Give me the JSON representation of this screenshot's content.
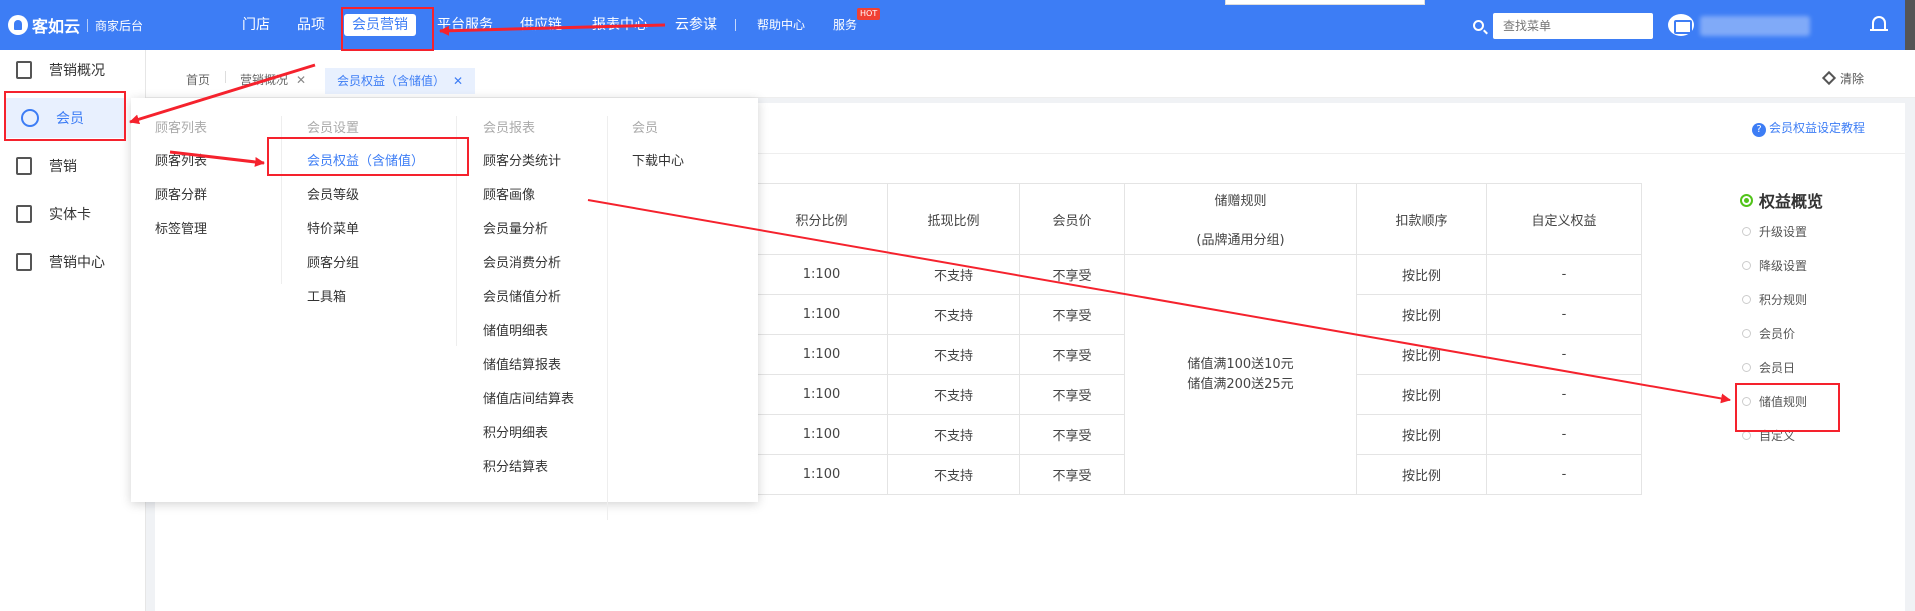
{
  "topbar": {
    "logo_name": "客如云",
    "logo_sub": "商家后台",
    "nav": [
      "门店",
      "品项",
      "会员营销",
      "平台服务",
      "供应链",
      "报表中心",
      "云参谋",
      "帮助中心",
      "服务"
    ],
    "hot_badge": "HOT",
    "search_placeholder": "查找菜单"
  },
  "sidebar": {
    "items": [
      {
        "label": "营销概况"
      },
      {
        "label": "会员"
      },
      {
        "label": "营销"
      },
      {
        "label": "实体卡"
      },
      {
        "label": "营销中心"
      }
    ]
  },
  "tabs": {
    "items": [
      "首页",
      "营销概况",
      "会员权益（含储值）"
    ],
    "clear_label": "清除"
  },
  "main": {
    "help_link": "会员权益设定教程"
  },
  "dropdown": {
    "columns": [
      {
        "header": "顾客列表",
        "items": [
          "顾客列表",
          "顾客分群",
          "标签管理"
        ]
      },
      {
        "header": "会员设置",
        "items": [
          "会员权益（含储值）",
          "会员等级",
          "特价菜单",
          "顾客分组",
          "工具箱"
        ]
      },
      {
        "header": "会员报表",
        "items": [
          "顾客分类统计",
          "顾客画像",
          "会员量分析",
          "会员消费分析",
          "会员储值分析",
          "储值明细表",
          "储值结算报表",
          "储值店间结算表",
          "积分明细表",
          "积分结算表"
        ]
      },
      {
        "header": "会员",
        "items": [
          "下载中心"
        ]
      }
    ]
  },
  "table": {
    "headers": [
      "积分比例",
      "抵现比例",
      "会员价",
      "储赠规则",
      "扣款顺序",
      "自定义权益"
    ],
    "header_sub": "(品牌通用分组)",
    "rows": [
      [
        "1:100",
        "不支持",
        "不享受",
        "按比例",
        "-"
      ],
      [
        "1:100",
        "不支持",
        "不享受",
        "按比例",
        "-"
      ],
      [
        "1:100",
        "不支持",
        "不享受",
        "按比例",
        "-"
      ],
      [
        "1:100",
        "不支持",
        "不享受",
        "按比例",
        "-"
      ],
      [
        "1:100",
        "不支持",
        "不享受",
        "按比例",
        "-"
      ],
      [
        "1:100",
        "不支持",
        "不享受",
        "按比例",
        "-"
      ]
    ],
    "rule_lines": [
      "储值满100送10元",
      "储值满200送25元"
    ]
  },
  "overview": {
    "title": "权益概览",
    "items": [
      "升级设置",
      "降级设置",
      "积分规则",
      "会员价",
      "会员日",
      "储值规则",
      "自定义"
    ]
  },
  "colors": {
    "brand": "#3d7df5",
    "annotation": "#f5222d",
    "active_dot": "#52c41a"
  }
}
